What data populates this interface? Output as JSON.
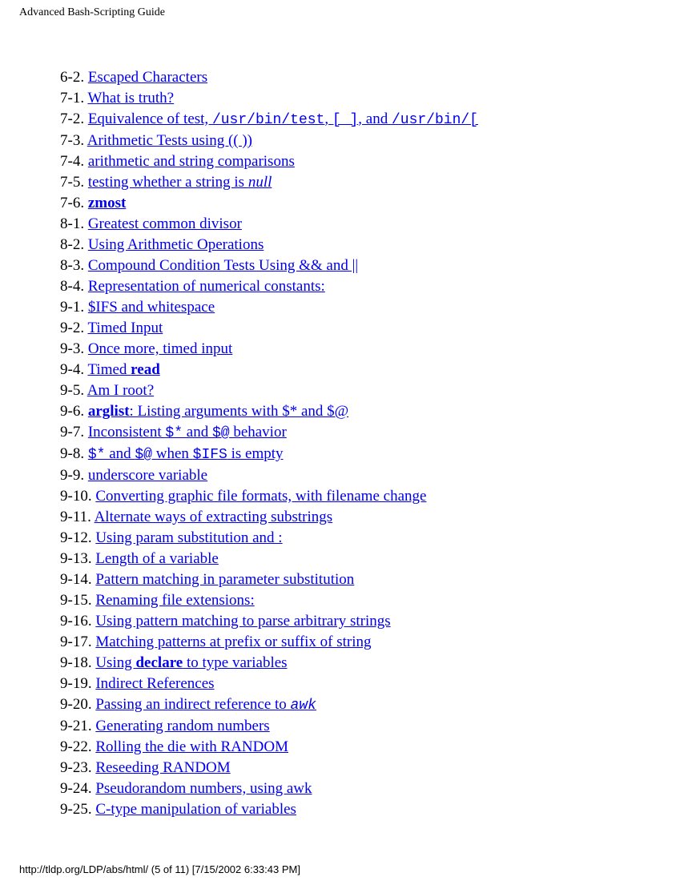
{
  "header": {
    "title": "Advanced Bash-Scripting Guide"
  },
  "footer": {
    "text": "http://tldp.org/LDP/abs/html/ (5 of 11) [7/15/2002 6:33:43 PM]"
  },
  "toc": [
    {
      "num": "6-2. ",
      "segments": [
        {
          "t": "Escaped Characters",
          "cls": ""
        }
      ]
    },
    {
      "num": "7-1. ",
      "segments": [
        {
          "t": "What is truth?",
          "cls": ""
        }
      ]
    },
    {
      "num": "7-2. ",
      "segments": [
        {
          "t": "Equivalence of test, ",
          "cls": ""
        },
        {
          "t": "/usr/bin/test",
          "cls": "mono"
        },
        {
          "t": ", ",
          "cls": ""
        },
        {
          "t": "[ ]",
          "cls": "mono"
        },
        {
          "t": ", and ",
          "cls": ""
        },
        {
          "t": "/usr/bin/[",
          "cls": "mono"
        }
      ]
    },
    {
      "num": "7-3. ",
      "segments": [
        {
          "t": "Arithmetic Tests using (( ))",
          "cls": ""
        }
      ]
    },
    {
      "num": "7-4. ",
      "segments": [
        {
          "t": "arithmetic and string comparisons",
          "cls": ""
        }
      ]
    },
    {
      "num": "7-5. ",
      "segments": [
        {
          "t": "testing whether a string is ",
          "cls": ""
        },
        {
          "t": "null",
          "cls": "italic"
        }
      ]
    },
    {
      "num": "7-6. ",
      "segments": [
        {
          "t": "zmost",
          "cls": "bold"
        }
      ]
    },
    {
      "num": "8-1. ",
      "segments": [
        {
          "t": "Greatest common divisor",
          "cls": ""
        }
      ]
    },
    {
      "num": "8-2. ",
      "segments": [
        {
          "t": "Using Arithmetic Operations",
          "cls": ""
        }
      ]
    },
    {
      "num": "8-3. ",
      "segments": [
        {
          "t": "Compound Condition Tests Using && and ||",
          "cls": ""
        }
      ]
    },
    {
      "num": "8-4. ",
      "segments": [
        {
          "t": "Representation of numerical constants:",
          "cls": ""
        }
      ]
    },
    {
      "num": "9-1. ",
      "segments": [
        {
          "t": "$IFS and whitespace",
          "cls": ""
        }
      ]
    },
    {
      "num": "9-2. ",
      "segments": [
        {
          "t": "Timed Input",
          "cls": ""
        }
      ]
    },
    {
      "num": "9-3. ",
      "segments": [
        {
          "t": "Once more, timed input",
          "cls": ""
        }
      ]
    },
    {
      "num": "9-4. ",
      "segments": [
        {
          "t": "Timed ",
          "cls": ""
        },
        {
          "t": "read",
          "cls": "bold"
        }
      ]
    },
    {
      "num": "9-5. ",
      "segments": [
        {
          "t": "Am I root?",
          "cls": ""
        }
      ]
    },
    {
      "num": "9-6. ",
      "segments": [
        {
          "t": "arglist",
          "cls": "bold"
        },
        {
          "t": ": Listing arguments with $* and $@",
          "cls": ""
        }
      ]
    },
    {
      "num": "9-7. ",
      "segments": [
        {
          "t": "Inconsistent ",
          "cls": ""
        },
        {
          "t": "$*",
          "cls": "mono"
        },
        {
          "t": " and ",
          "cls": ""
        },
        {
          "t": "$@",
          "cls": "mono"
        },
        {
          "t": " behavior",
          "cls": ""
        }
      ]
    },
    {
      "num": "9-8. ",
      "segments": [
        {
          "t": "$*",
          "cls": "mono"
        },
        {
          "t": " and ",
          "cls": ""
        },
        {
          "t": "$@",
          "cls": "mono"
        },
        {
          "t": " when ",
          "cls": ""
        },
        {
          "t": "$IFS",
          "cls": "mono"
        },
        {
          "t": " is empty",
          "cls": ""
        }
      ]
    },
    {
      "num": "9-9. ",
      "segments": [
        {
          "t": "underscore variable",
          "cls": ""
        }
      ]
    },
    {
      "num": "9-10. ",
      "segments": [
        {
          "t": "Converting graphic file formats, with filename change",
          "cls": ""
        }
      ]
    },
    {
      "num": "9-11. ",
      "segments": [
        {
          "t": "Alternate ways of extracting substrings",
          "cls": ""
        }
      ]
    },
    {
      "num": "9-12. ",
      "segments": [
        {
          "t": "Using param substitution and :",
          "cls": ""
        }
      ]
    },
    {
      "num": "9-13. ",
      "segments": [
        {
          "t": "Length of a variable",
          "cls": ""
        }
      ]
    },
    {
      "num": "9-14. ",
      "segments": [
        {
          "t": "Pattern matching in parameter substitution",
          "cls": ""
        }
      ]
    },
    {
      "num": "9-15. ",
      "segments": [
        {
          "t": "Renaming file extensions:",
          "cls": ""
        }
      ]
    },
    {
      "num": "9-16. ",
      "segments": [
        {
          "t": "Using pattern matching to parse arbitrary strings",
          "cls": ""
        }
      ]
    },
    {
      "num": "9-17. ",
      "segments": [
        {
          "t": "Matching patterns at prefix or suffix of string",
          "cls": ""
        }
      ]
    },
    {
      "num": "9-18. ",
      "segments": [
        {
          "t": "Using ",
          "cls": ""
        },
        {
          "t": "declare",
          "cls": "bold"
        },
        {
          "t": " to type variables",
          "cls": ""
        }
      ]
    },
    {
      "num": "9-19. ",
      "segments": [
        {
          "t": "Indirect References",
          "cls": ""
        }
      ]
    },
    {
      "num": "9-20. ",
      "segments": [
        {
          "t": "Passing an indirect reference to ",
          "cls": ""
        },
        {
          "t": "awk",
          "cls": "mono-italic"
        }
      ]
    },
    {
      "num": "9-21. ",
      "segments": [
        {
          "t": "Generating random numbers",
          "cls": ""
        }
      ]
    },
    {
      "num": "9-22. ",
      "segments": [
        {
          "t": "Rolling the die with RANDOM",
          "cls": ""
        }
      ]
    },
    {
      "num": "9-23. ",
      "segments": [
        {
          "t": "Reseeding RANDOM",
          "cls": ""
        }
      ]
    },
    {
      "num": "9-24. ",
      "segments": [
        {
          "t": "Pseudorandom numbers, using awk",
          "cls": ""
        }
      ]
    },
    {
      "num": "9-25. ",
      "segments": [
        {
          "t": "C-type manipulation of variables",
          "cls": ""
        }
      ]
    }
  ]
}
